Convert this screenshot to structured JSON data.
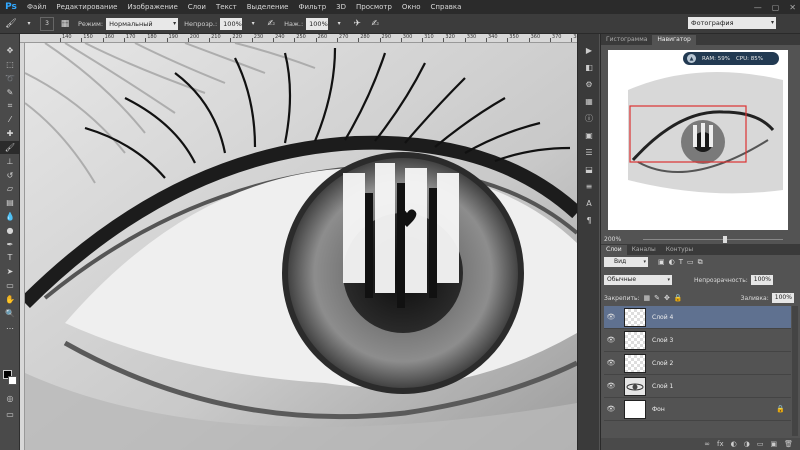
{
  "app": {
    "logo": "Ps"
  },
  "menu": [
    "Файл",
    "Редактирование",
    "Изображение",
    "Слои",
    "Текст",
    "Выделение",
    "Фильтр",
    "3D",
    "Просмотр",
    "Окно",
    "Справка"
  ],
  "window_controls": [
    "—",
    "▢",
    "✕"
  ],
  "options": {
    "brush_size": "3",
    "mode_label": "Режим:",
    "mode_value": "Нормальный",
    "opacity_label": "Непрозр.:",
    "opacity_value": "100%",
    "pressure_label": "Наж.:",
    "pressure_value": "100%",
    "workspace": "Фотография"
  },
  "ruler_top": [
    "140",
    "150",
    "160",
    "170",
    "180",
    "190",
    "200",
    "210",
    "220",
    "230",
    "240",
    "250",
    "260",
    "270",
    "280",
    "290",
    "300",
    "310",
    "320",
    "330",
    "340",
    "350",
    "360",
    "370",
    "380"
  ],
  "tools": [
    {
      "name": "move-tool-icon",
      "glyph": "✥"
    },
    {
      "name": "marquee-tool-icon",
      "glyph": "⬚"
    },
    {
      "name": "lasso-tool-icon",
      "glyph": "➰"
    },
    {
      "name": "quick-select-tool-icon",
      "glyph": "✎"
    },
    {
      "name": "crop-tool-icon",
      "glyph": "⌗"
    },
    {
      "name": "eyedropper-tool-icon",
      "glyph": "⁄"
    },
    {
      "name": "healing-tool-icon",
      "glyph": "✚"
    },
    {
      "name": "brush-tool-icon",
      "glyph": "🖌"
    },
    {
      "name": "stamp-tool-icon",
      "glyph": "⊥"
    },
    {
      "name": "history-brush-tool-icon",
      "glyph": "↺"
    },
    {
      "name": "eraser-tool-icon",
      "glyph": "▱"
    },
    {
      "name": "gradient-tool-icon",
      "glyph": "▤"
    },
    {
      "name": "blur-tool-icon",
      "glyph": "💧"
    },
    {
      "name": "dodge-tool-icon",
      "glyph": "●"
    },
    {
      "name": "pen-tool-icon",
      "glyph": "✒"
    },
    {
      "name": "type-tool-icon",
      "glyph": "T"
    },
    {
      "name": "path-select-tool-icon",
      "glyph": "➤"
    },
    {
      "name": "shape-tool-icon",
      "glyph": "▭"
    },
    {
      "name": "hand-tool-icon",
      "glyph": "✋"
    },
    {
      "name": "zoom-tool-icon",
      "glyph": "🔍"
    },
    {
      "name": "more-tools-icon",
      "glyph": "…"
    }
  ],
  "mini_panel": [
    "▶",
    "◧",
    "⚙",
    "▦",
    "ⓘ",
    "▣",
    "☰",
    "⬓",
    "≡",
    "A",
    "¶"
  ],
  "navigator": {
    "tabs": [
      "Гистограмма",
      "Навигатор"
    ],
    "zoom": "200%",
    "resources": {
      "ram": "RAM: 59%",
      "cpu": "CPU: 85%"
    }
  },
  "layers_panel": {
    "tabs": [
      "Слои",
      "Каналы",
      "Контуры"
    ],
    "filter": "Вид",
    "blend_mode": "Обычные",
    "opacity_label": "Непрозрачность:",
    "opacity_value": "100%",
    "lock_label": "Закрепить:",
    "fill_label": "Заливка:",
    "fill_value": "100%",
    "layers": [
      {
        "name": "Слой 4",
        "selected": true
      },
      {
        "name": "Слой 3",
        "selected": false
      },
      {
        "name": "Слой 2",
        "selected": false
      },
      {
        "name": "Слой 1",
        "selected": false
      },
      {
        "name": "Фон",
        "selected": false
      }
    ],
    "footer_icons": [
      "∞",
      "fx",
      "◐",
      "◑",
      "▭",
      "▣",
      "🗑"
    ]
  }
}
